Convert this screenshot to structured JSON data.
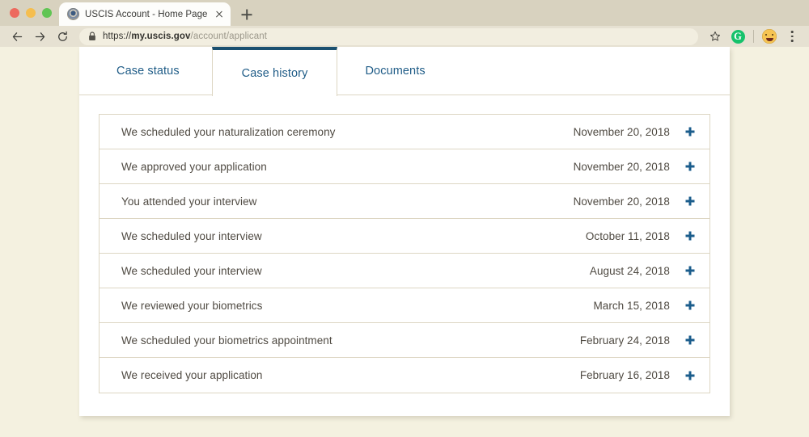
{
  "browser": {
    "traffic_lights": [
      {
        "name": "close",
        "color": "#ED6A5E"
      },
      {
        "name": "minimize",
        "color": "#F5BE4F"
      },
      {
        "name": "zoom",
        "color": "#61C554"
      }
    ],
    "tab": {
      "title": "USCIS Account - Home Page",
      "favicon": "uscis-seal-icon",
      "close_icon": "close-icon"
    },
    "new_tab_icon": "plus-icon",
    "nav": {
      "back_icon": "arrow-left-icon",
      "forward_icon": "arrow-right-icon",
      "reload_icon": "reload-icon"
    },
    "omnibox": {
      "lock_icon": "lock-icon",
      "url_scheme": "https://",
      "url_domain": "my.uscis.gov",
      "url_path": "/account/applicant"
    },
    "actions": {
      "bookmark_icon": "star-icon",
      "grammarly_label": "G",
      "avatar_icon": "emoji-avatar-icon",
      "menu_icon": "three-dot-menu-icon"
    }
  },
  "page": {
    "tabs": [
      {
        "label": "Case status",
        "active": false
      },
      {
        "label": "Case history",
        "active": true
      },
      {
        "label": "Documents",
        "active": false
      }
    ],
    "history": {
      "expand_icon": "plus-icon",
      "rows": [
        {
          "label": "We scheduled your naturalization ceremony",
          "date": "November 20, 2018"
        },
        {
          "label": "We approved your application",
          "date": "November 20, 2018"
        },
        {
          "label": "You attended your interview",
          "date": "November 20, 2018"
        },
        {
          "label": "We scheduled your interview",
          "date": "October 11, 2018"
        },
        {
          "label": "We scheduled your interview",
          "date": "August 24, 2018"
        },
        {
          "label": "We reviewed your biometrics",
          "date": "March 15, 2018"
        },
        {
          "label": "We scheduled your biometrics appointment",
          "date": "February 24, 2018"
        },
        {
          "label": "We received your application",
          "date": "February 16, 2018"
        }
      ]
    }
  },
  "colors": {
    "page_background": "#F4F1E0",
    "card_background": "#FFFFFF",
    "accent_blue": "#1B5070",
    "link_blue": "#1F5C87",
    "plus_blue": "#1B5D8C",
    "border_tan": "#DDD6C3",
    "text_body": "#4F4A42"
  }
}
